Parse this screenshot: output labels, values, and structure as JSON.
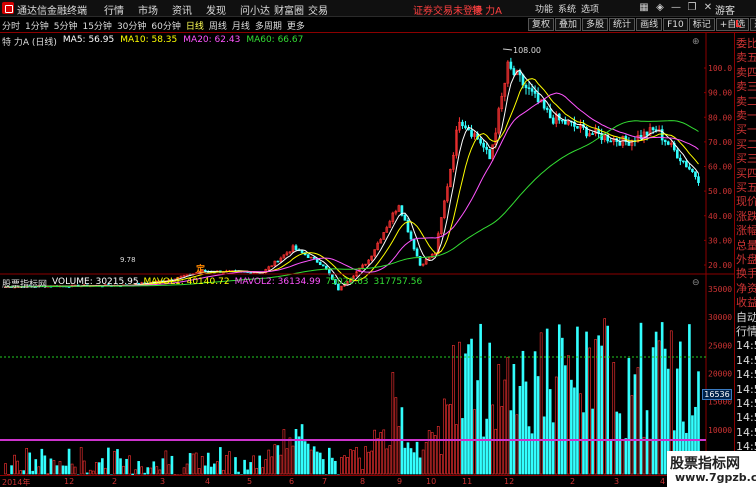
{
  "titlebar": {
    "app_title": "通达信金融终端",
    "menu": [
      "行情",
      "市场",
      "资讯",
      "发现",
      "问小达",
      "财富圈",
      "交易"
    ],
    "login_status": "证券交易未登录",
    "stock_name": "特 力A",
    "tools": [
      "功能",
      "系统",
      "选项"
    ],
    "guest": "游客"
  },
  "toolbar": {
    "period_tabs": [
      "分时",
      "1分钟",
      "5分钟",
      "15分钟",
      "30分钟",
      "60分钟",
      "日线",
      "周线",
      "月线",
      "多周期",
      "更多"
    ],
    "active_tab": "日线",
    "right_tools": [
      "复权",
      "叠加",
      "多股",
      "统计",
      "画线",
      "F10",
      "标记",
      "+自选",
      "返回"
    ]
  },
  "info_line": {
    "name": "特 力A (日线)",
    "ma5": "MA5: 56.95",
    "ma10": "MA10: 58.35",
    "ma20": "MA20: 62.43",
    "ma60": "MA60: 66.67"
  },
  "price_chart": {
    "y_labels": [
      "100.0",
      "90.00",
      "80.00",
      "70.00",
      "60.00",
      "50.00",
      "40.00",
      "30.00",
      "20.00"
    ],
    "y_values": [
      100,
      90,
      80,
      70,
      60,
      50,
      40,
      30,
      20
    ],
    "high_marker": "108.00",
    "low_marker": "9.78",
    "ding_label": "定"
  },
  "volume_header": {
    "indicator": "股票指标网",
    "volume": "VOLUME: 30215.95",
    "mavol1": "MAVOL1: 40140.72",
    "mavol2": "MAVOL2: 36134.99",
    "v3": "75020.63",
    "v4": "317757.56"
  },
  "volume_chart": {
    "y_labels": [
      "35000",
      "30000",
      "25000",
      "20000",
      "15000",
      "10000",
      "5000"
    ],
    "y_values": [
      35000,
      30000,
      25000,
      20000,
      15000,
      10000,
      5000
    ],
    "cursor_value": "16536"
  },
  "side_panel": {
    "corner": "L",
    "items": [
      "委比",
      "卖五",
      "卖四",
      "卖三",
      "卖二",
      "卖一",
      "买一",
      "买二",
      "买三",
      "买四",
      "买五",
      "现价",
      "涨跌",
      "涨幅",
      "总量",
      "外盘",
      "换手",
      "净资",
      "收益",
      "自动",
      "行情",
      "14:50",
      "14:50",
      "14:50",
      "14:50",
      "14:50",
      "14:50",
      "14:50",
      "14:50",
      "14:50"
    ]
  },
  "date_axis": [
    "2014年",
    "12",
    "2",
    "3",
    "4",
    "5",
    "6",
    "7",
    "8",
    "9",
    "10",
    "11",
    "12",
    "2",
    "3",
    "4"
  ],
  "watermark": {
    "line1": "股票指标网",
    "line2": "www.7gpzb.com"
  },
  "colors": {
    "up": "#ff3333",
    "down": "#33ffff",
    "ma5": "#ffffff",
    "ma10": "#ffff00",
    "ma20": "#ff55ff",
    "ma60": "#33dd33"
  }
}
